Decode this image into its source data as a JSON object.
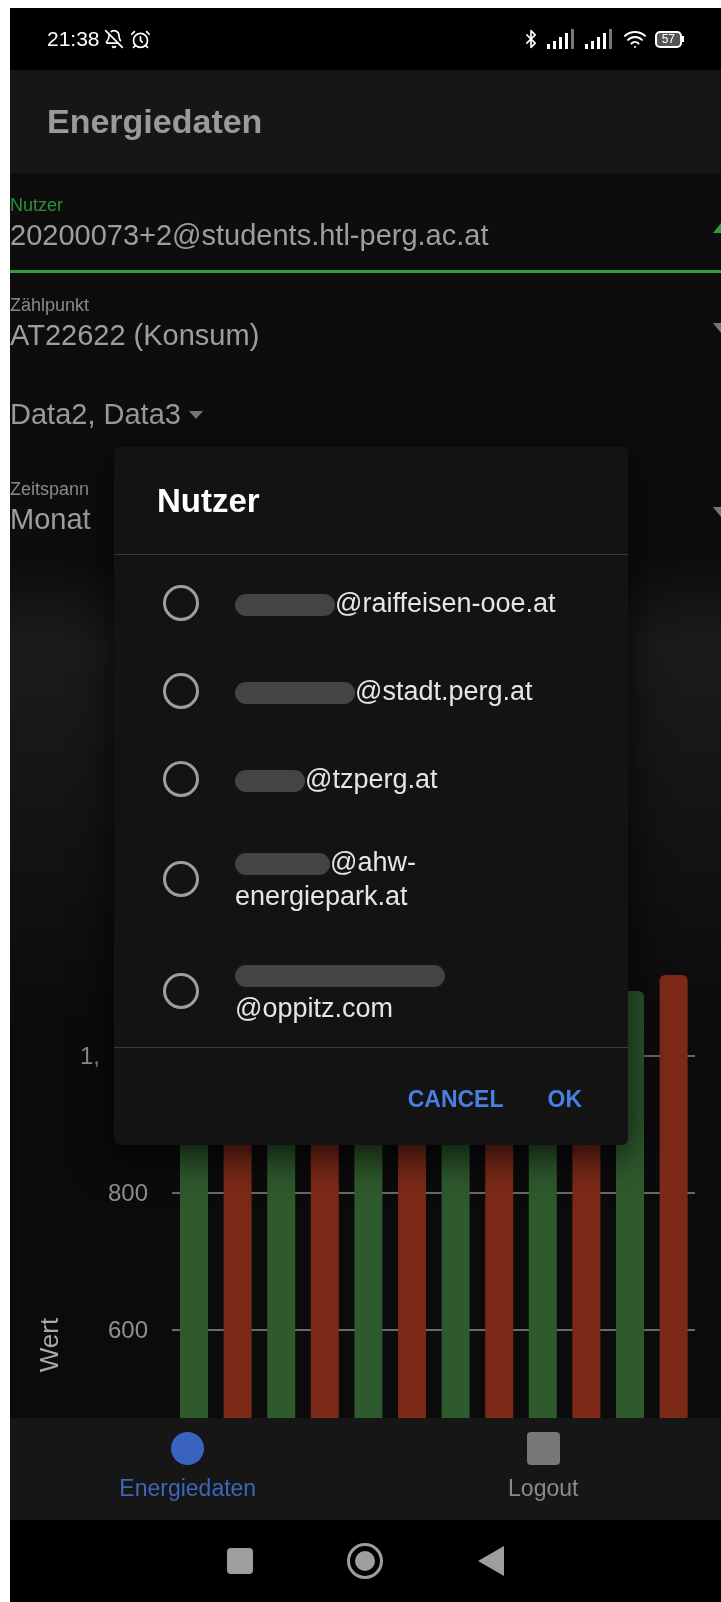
{
  "status_bar": {
    "time": "21:38",
    "battery": "57"
  },
  "app_bar": {
    "title": "Energiedaten"
  },
  "fields": [
    {
      "kind": "select",
      "label": "Nutzer",
      "value": "20200073+2@students.htl-perg.ac.at",
      "expanded": true
    },
    {
      "kind": "select",
      "label": "Zählpunkt",
      "value": "AT22622 (Konsum)",
      "expanded": false
    },
    {
      "kind": "multiselect",
      "value": "Data2, Data3"
    },
    {
      "kind": "select",
      "label": "Zeitspann",
      "value": "Monat",
      "expanded": false
    }
  ],
  "chart": {
    "y_axis_title": "Wert",
    "y_tick_labels": [
      "1,",
      "800",
      "600"
    ]
  },
  "dialog": {
    "title": "Nutzer",
    "options": [
      {
        "label": "@raiffeisen-ooe.at",
        "redacted": true,
        "selected": false
      },
      {
        "label": "@stadt.perg.at",
        "redacted": true,
        "selected": false
      },
      {
        "label": "@tzperg.at",
        "redacted": true,
        "selected": false
      },
      {
        "label": "@ahw-energiepark.at",
        "redacted": true,
        "selected": false
      },
      {
        "label": "@oppitz.com",
        "redacted": true,
        "selected": false
      }
    ],
    "buttons": [
      "CANCEL",
      "OK"
    ]
  },
  "bottom_nav": [
    {
      "label": "Energiedaten",
      "kind": "dot",
      "selected": true
    },
    {
      "label": "Logout",
      "kind": "square",
      "selected": false
    }
  ]
}
